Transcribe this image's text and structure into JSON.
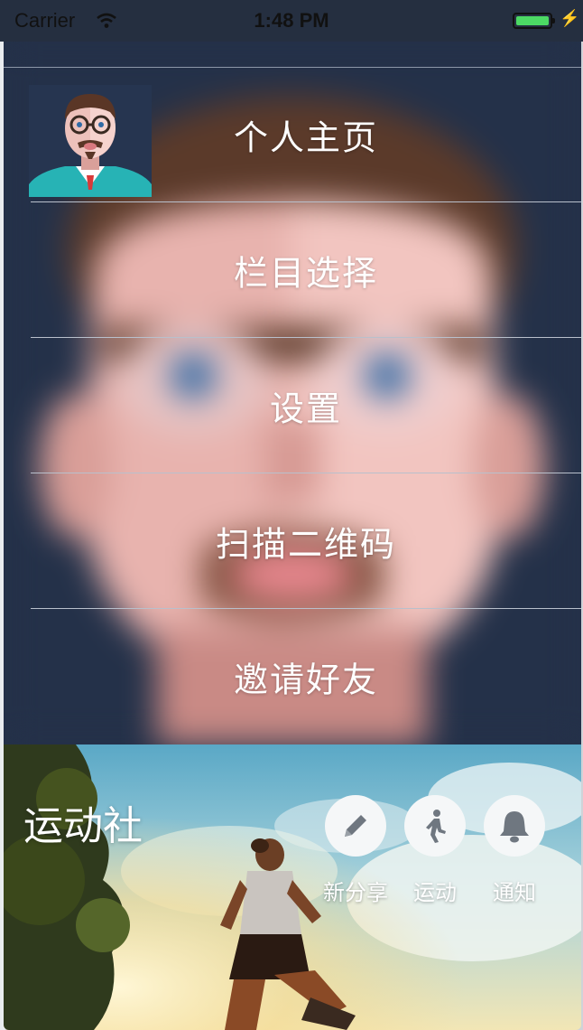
{
  "status_bar": {
    "carrier": "Carrier",
    "time": "1:48 PM",
    "battery_level": 1.0
  },
  "menu": {
    "items": [
      {
        "label": "个人主页"
      },
      {
        "label": "栏目选择"
      },
      {
        "label": "设置"
      },
      {
        "label": "扫描二维码"
      },
      {
        "label": "邀请好友"
      }
    ]
  },
  "header": {
    "title": "运动社",
    "actions": [
      {
        "label": "新分享",
        "icon": "pencil-icon"
      },
      {
        "label": "运动",
        "icon": "runner-icon"
      },
      {
        "label": "通知",
        "icon": "bell-icon"
      }
    ]
  },
  "colors": {
    "menu_background": "#243149",
    "text": "#ffffff",
    "battery": "#4cd964"
  }
}
